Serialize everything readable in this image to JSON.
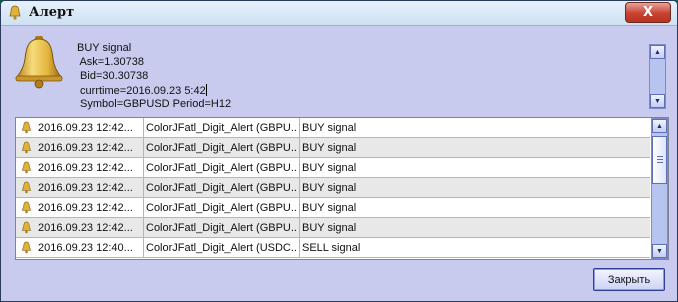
{
  "window": {
    "title": "Алерт",
    "close_glyph": "X"
  },
  "message": {
    "lines": [
      "BUY signal",
      " Ask=1.30738",
      " Bid=30.30738",
      " currtime=2016.09.23 5:42",
      " Symbol=GBPUSD Period=H12"
    ]
  },
  "alerts": [
    {
      "time": "2016.09.23 12:42...",
      "expert": "ColorJFatl_Digit_Alert (GBPU...",
      "message": "BUY signal"
    },
    {
      "time": "2016.09.23 12:42...",
      "expert": "ColorJFatl_Digit_Alert (GBPU...",
      "message": "BUY signal"
    },
    {
      "time": "2016.09.23 12:42...",
      "expert": "ColorJFatl_Digit_Alert (GBPU...",
      "message": "BUY signal"
    },
    {
      "time": "2016.09.23 12:42...",
      "expert": "ColorJFatl_Digit_Alert (GBPU...",
      "message": "BUY signal"
    },
    {
      "time": "2016.09.23 12:42...",
      "expert": "ColorJFatl_Digit_Alert (GBPU...",
      "message": "BUY signal"
    },
    {
      "time": "2016.09.23 12:42...",
      "expert": "ColorJFatl_Digit_Alert (GBPU...",
      "message": "BUY signal"
    },
    {
      "time": "2016.09.23 12:40...",
      "expert": "ColorJFatl_Digit_Alert (USDC...",
      "message": "SELL signal"
    }
  ],
  "buttons": {
    "close_label": "Закрыть"
  },
  "icons": {
    "title": "bell-icon",
    "message": "bell-icon",
    "row": "bell-icon"
  },
  "colors": {
    "dialog_bg": "#c8cbee",
    "close_red": "#c7422f",
    "bell_gold": "#e0b23a"
  }
}
